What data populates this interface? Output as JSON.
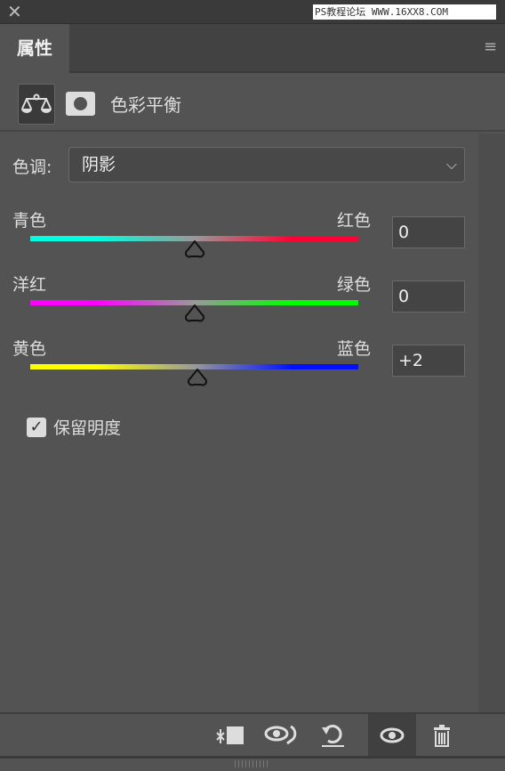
{
  "window": {
    "close_icon": "close-icon",
    "watermark": "PS教程论坛 WWW.16XX8.COM"
  },
  "panel": {
    "tab": "属性",
    "menu_icon": "hamburger-menu-icon"
  },
  "header": {
    "title": "色彩平衡",
    "icons": [
      "balance-scale-icon",
      "mask-icon"
    ]
  },
  "tone": {
    "label": "色调:",
    "value": "阴影"
  },
  "sliders": [
    {
      "left": "青色",
      "right": "红色",
      "value": "0",
      "num": 0,
      "left_color": "#00ffe0",
      "right_color": "#ff0030"
    },
    {
      "left": "洋红",
      "right": "绿色",
      "value": "0",
      "num": 0,
      "left_color": "#ff00ff",
      "right_color": "#00ff00"
    },
    {
      "left": "黄色",
      "right": "蓝色",
      "value": "+2",
      "num": 2,
      "left_color": "#ffff00",
      "right_color": "#0010ff"
    }
  ],
  "slider_range": [
    -100,
    100
  ],
  "preserve": {
    "label": "保留明度",
    "checked": true
  },
  "toolbar": [
    "clip-to-layer-icon",
    "view-previous-state-icon",
    "reset-icon",
    "visibility-eye-icon",
    "trash-icon"
  ]
}
